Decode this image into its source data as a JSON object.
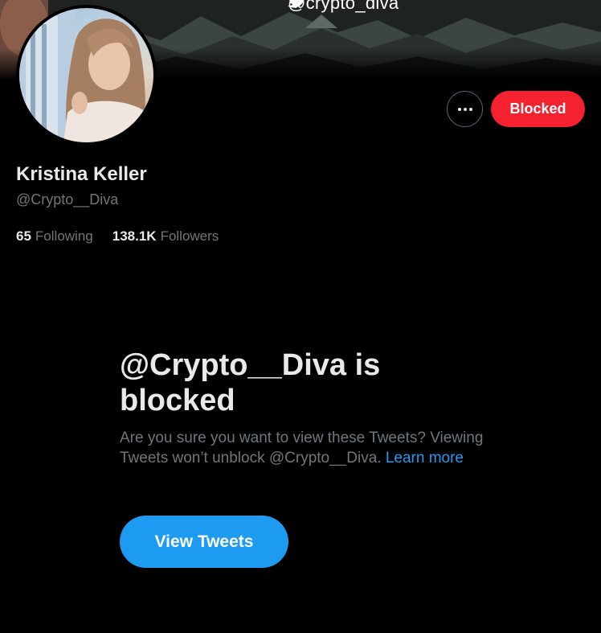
{
  "banner": {
    "handle": "@crypto_diva",
    "icon": "twitter-bird-icon"
  },
  "profile": {
    "display_name": "Kristina Keller",
    "username": "@Crypto__Diva",
    "following_count": "65",
    "following_label": "Following",
    "followers_count": "138.1K",
    "followers_label": "Followers"
  },
  "actions": {
    "more_icon": "more-horizontal-icon",
    "blocked_label": "Blocked"
  },
  "blocked_notice": {
    "title": "@Crypto__Diva is blocked",
    "description": "Are you sure you want to view these Tweets? Viewing Tweets won’t unblock @Crypto__Diva.",
    "learn_more": "Learn more",
    "view_button": "View Tweets"
  },
  "colors": {
    "background": "#000000",
    "blocked_red": "#f4212e",
    "accent_blue": "#1d9bf0",
    "secondary_text": "#71767b",
    "primary_text": "#e7e9ea"
  }
}
